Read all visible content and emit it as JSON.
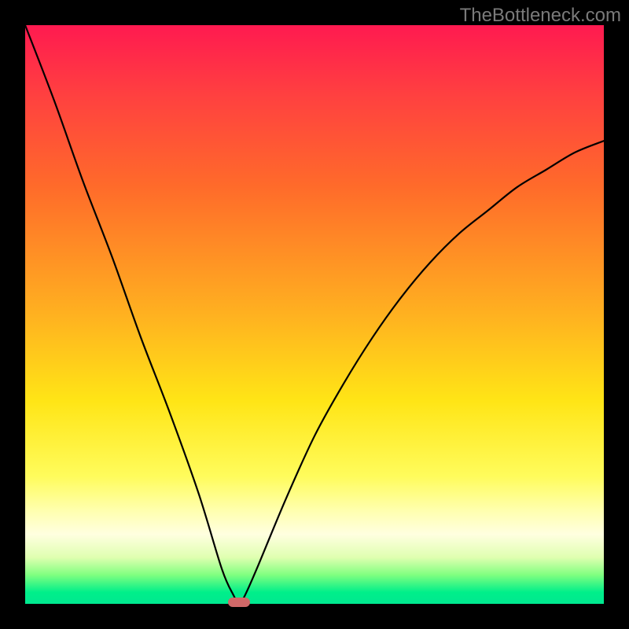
{
  "watermark": "TheBottleneck.com",
  "colors": {
    "gradient_top": "#ff1a50",
    "gradient_mid": "#ffe516",
    "gradient_bottom": "#00e890",
    "frame": "#000000",
    "curve": "#000000",
    "marker": "#d06868"
  },
  "chart_data": {
    "type": "line",
    "title": "",
    "xlabel": "",
    "ylabel": "",
    "xlim": [
      0,
      100
    ],
    "ylim": [
      0,
      100
    ],
    "grid": false,
    "legend": false,
    "annotations": [
      "TheBottleneck.com"
    ],
    "marker": {
      "x": 37,
      "y": 0
    },
    "series": [
      {
        "name": "curve",
        "x": [
          0,
          5,
          10,
          15,
          20,
          25,
          30,
          34,
          36,
          37,
          38,
          40,
          45,
          50,
          55,
          60,
          65,
          70,
          75,
          80,
          85,
          90,
          95,
          100
        ],
        "values": [
          100,
          87,
          73,
          60,
          46,
          33,
          19,
          6,
          1.5,
          0,
          1.5,
          6,
          18,
          29,
          38,
          46,
          53,
          59,
          64,
          68,
          72,
          75,
          78,
          80
        ]
      }
    ]
  }
}
